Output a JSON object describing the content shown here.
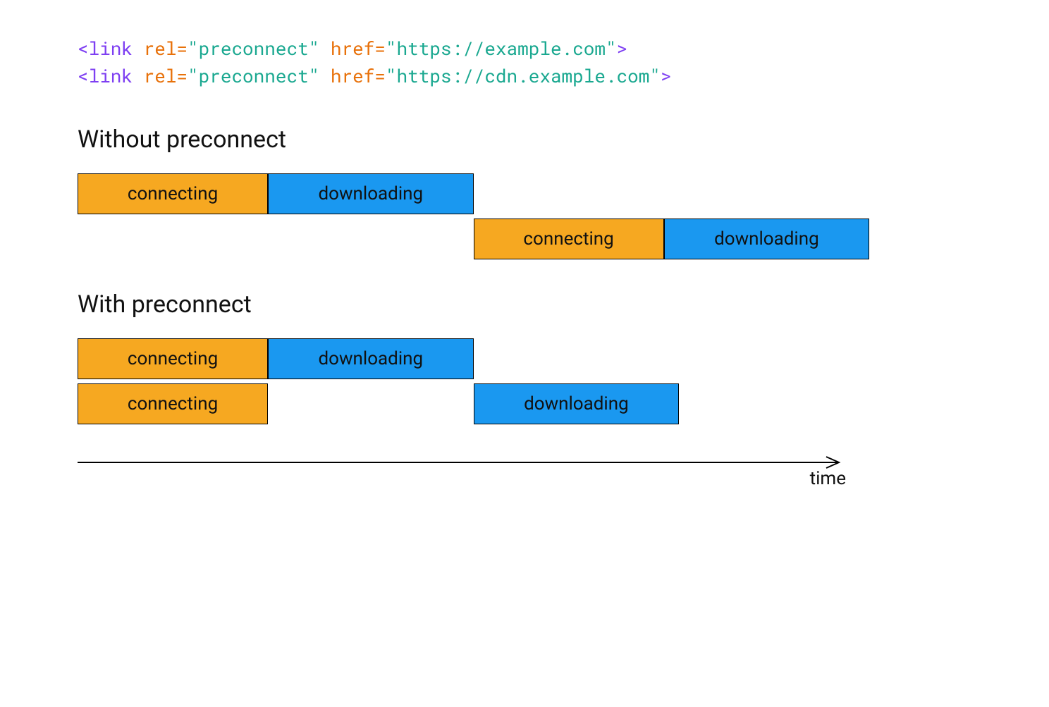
{
  "code": {
    "line1": {
      "tag_open": "<link ",
      "attr1": "rel=",
      "val1": "\"preconnect\" ",
      "attr2": "href=",
      "val2": "\"https://example.com\"",
      "tag_close": ">"
    },
    "line2": {
      "tag_open": "<link ",
      "attr1": "rel=",
      "val1": "\"preconnect\" ",
      "attr2": "href=",
      "val2": "\"https://cdn.example.com\"",
      "tag_close": ">"
    }
  },
  "sections": {
    "without": {
      "title": "Without preconnect",
      "rows": [
        [
          {
            "label": "connecting",
            "type": "connecting",
            "flex": 25
          },
          {
            "label": "downloading",
            "type": "downloading",
            "flex": 27
          },
          {
            "label": "",
            "type": "gap",
            "flex": 48
          }
        ],
        [
          {
            "label": "",
            "type": "gap",
            "flex": 52
          },
          {
            "label": "connecting",
            "type": "connecting",
            "flex": 25
          },
          {
            "label": "downloading",
            "type": "downloading",
            "flex": 27
          }
        ]
      ]
    },
    "with": {
      "title": "With preconnect",
      "rows": [
        [
          {
            "label": "connecting",
            "type": "connecting",
            "flex": 25
          },
          {
            "label": "downloading",
            "type": "downloading",
            "flex": 27
          },
          {
            "label": "",
            "type": "gap",
            "flex": 48
          }
        ],
        [
          {
            "label": "connecting",
            "type": "connecting",
            "flex": 25
          },
          {
            "label": "",
            "type": "gap",
            "flex": 27
          },
          {
            "label": "downloading",
            "type": "downloading",
            "flex": 27
          },
          {
            "label": "",
            "type": "gap",
            "flex": 21
          }
        ]
      ]
    }
  },
  "axis": {
    "label": "time"
  },
  "colors": {
    "connecting": "#f6a821",
    "downloading": "#1a98f0"
  }
}
